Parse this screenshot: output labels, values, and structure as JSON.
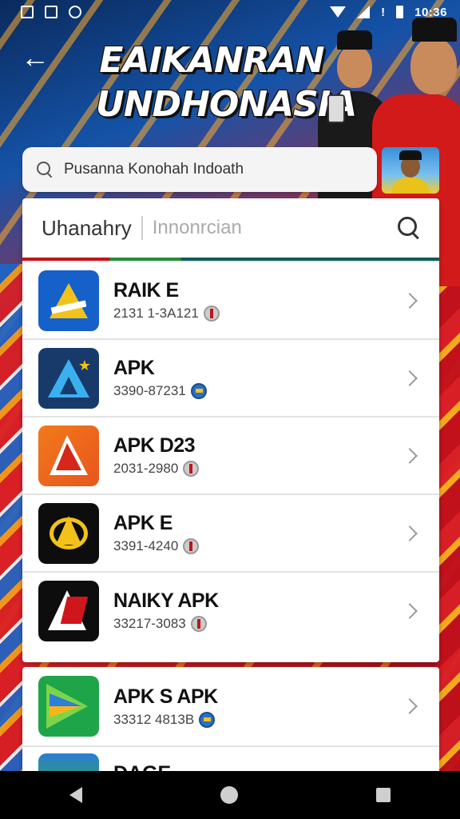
{
  "status_bar": {
    "time": "10:36",
    "left_icons": [
      "image-icon",
      "edit-icon",
      "record-icon"
    ],
    "right_icons": [
      "wifi-icon",
      "signal-icon",
      "alert-icon",
      "battery-icon"
    ]
  },
  "header": {
    "back_icon": "arrow-left-icon",
    "title_line1": "EAIKANRAN",
    "title_line2": "UNDHONASIA"
  },
  "search": {
    "query": "Pusanna Konohah Indoath"
  },
  "list_header": {
    "title": "Uhanahry",
    "placeholder": "Innonrcian"
  },
  "apps": [
    {
      "name": "RAIK E",
      "size": "2131 1-3A121",
      "badge": "grey"
    },
    {
      "name": "APK",
      "size": "3390-87231",
      "badge": "blue"
    },
    {
      "name": "APK D23",
      "size": "2031-2980",
      "badge": "grey"
    },
    {
      "name": "APK E",
      "size": "3391-4240",
      "badge": "grey"
    },
    {
      "name": "NAIKY APK",
      "size": "33217-3083",
      "badge": "grey"
    },
    {
      "name": "APK S APK",
      "size": "33312 4813B",
      "badge": "blue"
    }
  ],
  "partial_app": {
    "name": "DAGE"
  },
  "colors": {
    "accent_red": "#c8161d",
    "accent_yellow": "#f2c21b",
    "accent_blue": "#1660c9"
  }
}
